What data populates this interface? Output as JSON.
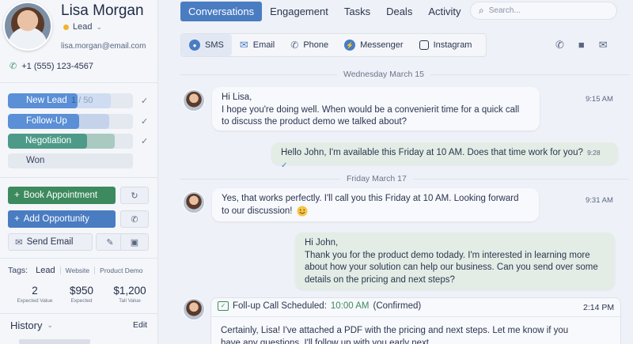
{
  "contact": {
    "name": "Lisa Morgan",
    "status": "Lead",
    "email": "lisa.morgan@email.com",
    "phone": "+1 (555) 123-4567"
  },
  "pipeline": {
    "stages": [
      {
        "label": "New Lead",
        "count": "1",
        "total": "/ 50",
        "checked": true
      },
      {
        "label": "Follow-Up",
        "checked": true
      },
      {
        "label": "Negotiation",
        "checked": true
      },
      {
        "label": "Won",
        "checked": false
      }
    ]
  },
  "actions": {
    "book": "Book Appointment",
    "opportunity": "Add Opportunity",
    "send_email": "Send Email"
  },
  "tags": {
    "label": "Tags:",
    "items": [
      "Lead",
      "Website",
      "Product Demo"
    ]
  },
  "stats": [
    {
      "value": "2",
      "label": "Expected Value"
    },
    {
      "value": "$950",
      "label": "Expected"
    },
    {
      "value": "$1,200",
      "label": "Tall Value"
    }
  ],
  "history": {
    "label": "History",
    "edit": "Edit"
  },
  "nav": {
    "tabs": [
      "Conversations",
      "Engagement",
      "Tasks",
      "Deals",
      "Activity"
    ],
    "search_placeholder": "Search..."
  },
  "channels": [
    "SMS",
    "Email",
    "Phone",
    "Messenger",
    "Instagram"
  ],
  "thread": {
    "day1": "Wednesday March 15",
    "day2": "Friday March 17",
    "m1": {
      "line1": "Hi Lisa,",
      "line2": "I hope you're doing well. When would be a convenierit time for a quick call",
      "line3": "to discuss the product demo we talked about?",
      "time": "9:15 AM"
    },
    "m2": {
      "text": "Hello John, I'm available this Friday at 10 AM. Does that time work for you?",
      "time": "9:28"
    },
    "m3": {
      "line1": "Yes, that works perfectly. I'll call you this Friday at 10 AM. Looking forward",
      "line2": "to our discussion!",
      "time": "9:31 AM"
    },
    "m4": {
      "line1": "Hi John,",
      "line2": "Thank you for the product demo todady. I'm  interested in learning more",
      "line3": "about how your solution can help our business. Can you send over some",
      "line4": "details on the pricing and next steps?"
    },
    "followup": {
      "label": "Foll-up Call Scheduled:",
      "when": "10:00 AM",
      "state": "(Confirmed)",
      "time": "2:14 PM",
      "line1": "Certainly, Lisa! I've attached a PDF with the pricing  and next steps.  Let me know if you",
      "line2": "have any questions. I'll follow up with you early next"
    }
  },
  "colors": {
    "accent": "#4a7cc2",
    "green": "#3d8a5e",
    "stage_blue": "#5b8fd6",
    "stage_teal": "#4e9a88",
    "stage_gray": "#c9d0dc"
  }
}
